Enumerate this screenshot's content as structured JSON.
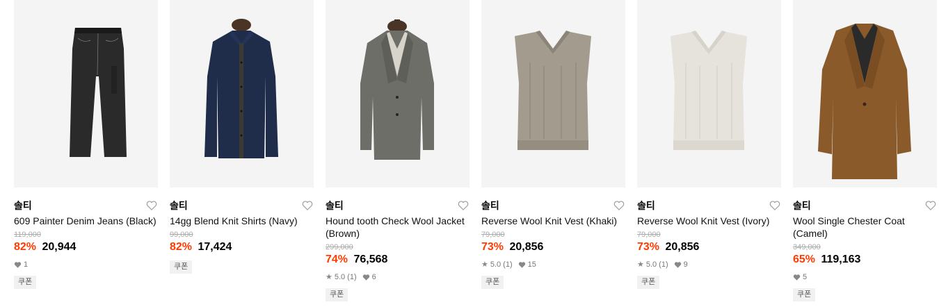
{
  "products": [
    {
      "brand": "솔티",
      "title": "609 Painter Denim Jeans (Black)",
      "original_price": "119,000",
      "discount": "82%",
      "price": "20,944",
      "rating": "",
      "reviews": "",
      "likes": "1",
      "badge": "쿠폰",
      "image": "black-denim-jeans"
    },
    {
      "brand": "솔티",
      "title": "14gg Blend Knit Shirts (Navy)",
      "original_price": "99,000",
      "discount": "82%",
      "price": "17,424",
      "rating": "",
      "reviews": "",
      "likes": "",
      "badge": "쿠폰",
      "image": "navy-knit-shirt"
    },
    {
      "brand": "솔티",
      "title": "Hound tooth Check Wool Jacket (Brown)",
      "original_price": "299,000",
      "discount": "74%",
      "price": "76,568",
      "rating": "5.0",
      "reviews": "(1)",
      "likes": "6",
      "badge": "쿠폰",
      "image": "houndstooth-jacket"
    },
    {
      "brand": "솔티",
      "title": "Reverse Wool Knit Vest (Khaki)",
      "original_price": "79,000",
      "discount": "73%",
      "price": "20,856",
      "rating": "5.0",
      "reviews": "(1)",
      "likes": "15",
      "badge": "쿠폰",
      "image": "khaki-knit-vest"
    },
    {
      "brand": "솔티",
      "title": "Reverse Wool Knit Vest (Ivory)",
      "original_price": "79,000",
      "discount": "73%",
      "price": "20,856",
      "rating": "5.0",
      "reviews": "(1)",
      "likes": "9",
      "badge": "쿠폰",
      "image": "ivory-knit-vest"
    },
    {
      "brand": "솔티",
      "title": "Wool Single Chester Coat (Camel)",
      "original_price": "349,000",
      "discount": "65%",
      "price": "119,163",
      "rating": "",
      "reviews": "",
      "likes": "5",
      "badge": "쿠폰",
      "image": "camel-wool-coat"
    }
  ],
  "colors": {
    "discount": "#ff3b00",
    "thumb_bg": "#f4f4f4",
    "icon_gray": "#888888"
  }
}
